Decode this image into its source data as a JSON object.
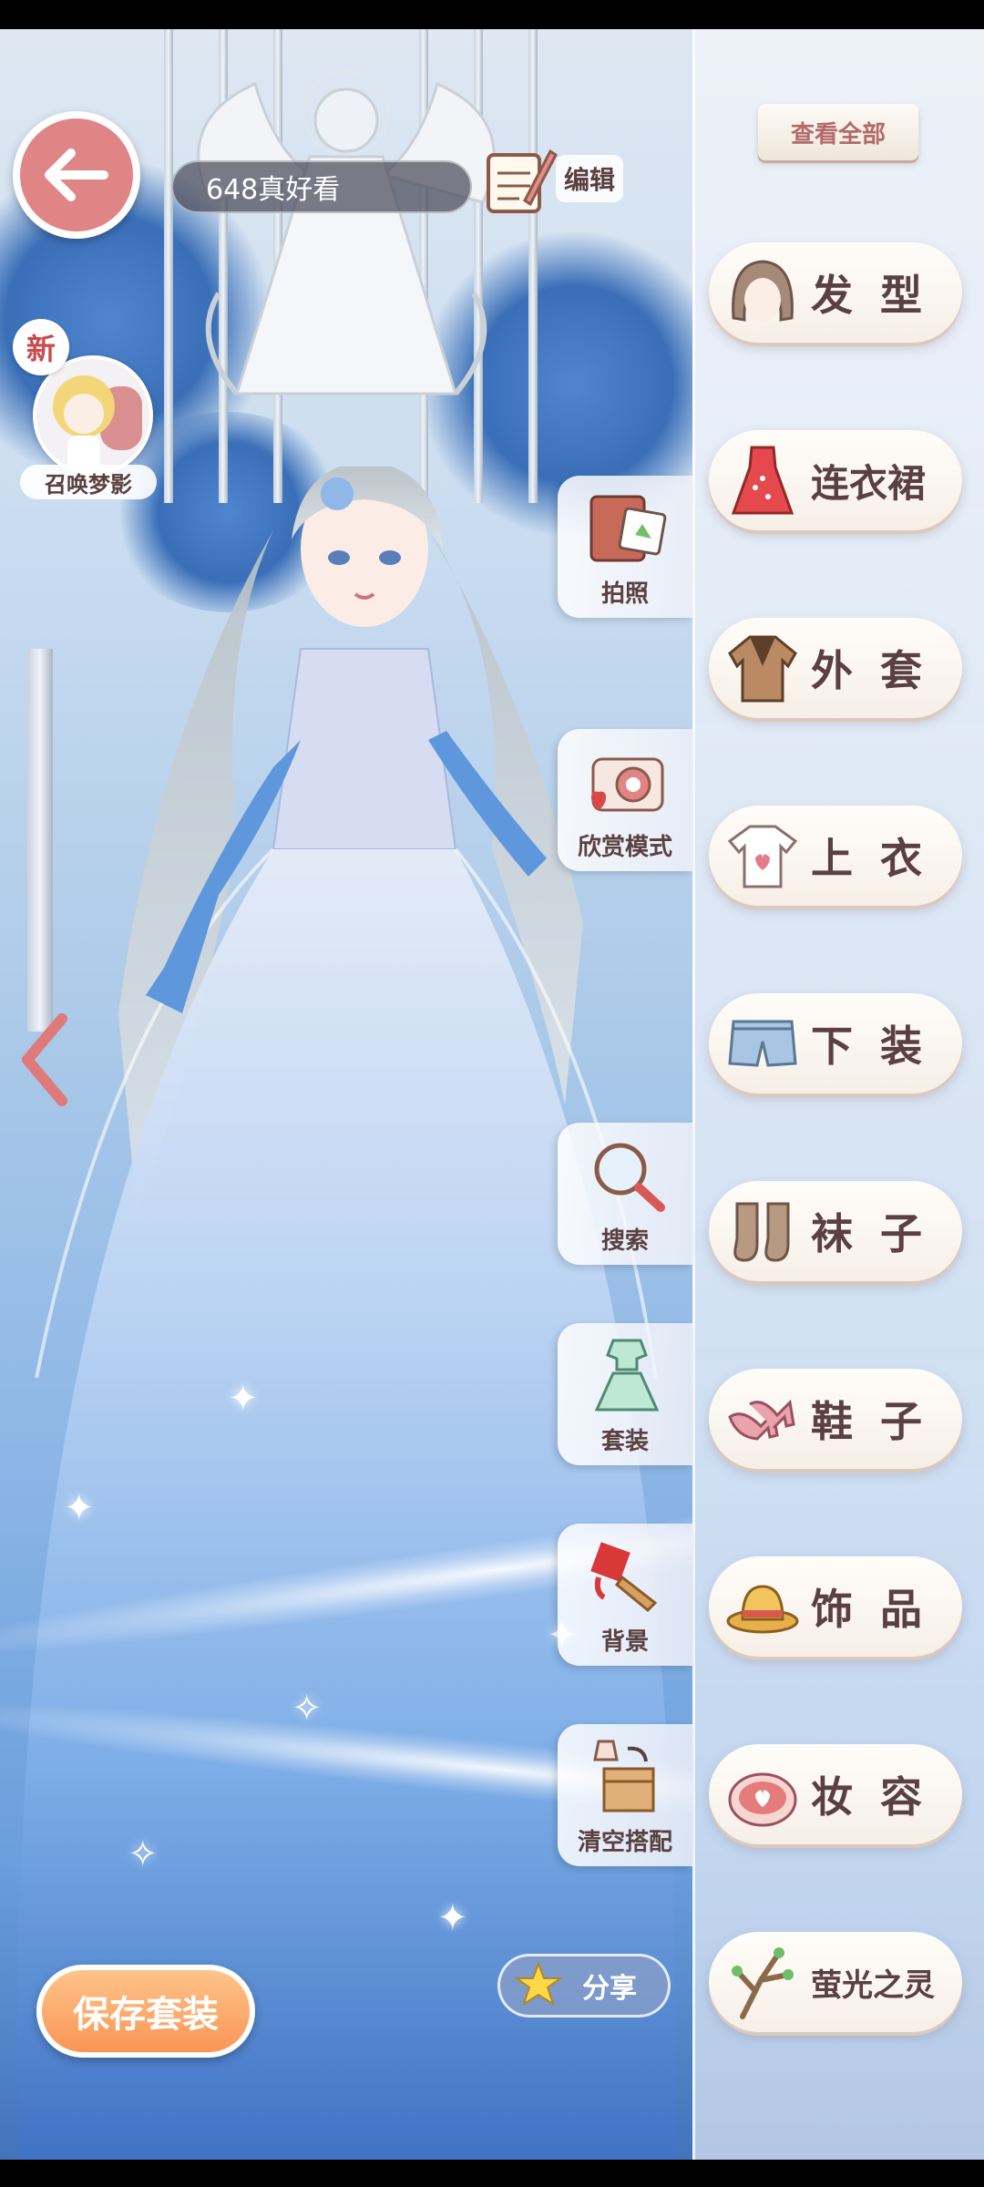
{
  "header": {
    "outfit_name": "648真好看",
    "edit_label": "编辑"
  },
  "summon": {
    "new_badge": "新",
    "label": "召唤梦影"
  },
  "panel": {
    "view_all": "查看全部",
    "categories": [
      {
        "label": "发型",
        "icon": "hair-icon"
      },
      {
        "label": "连衣裙",
        "icon": "dress-icon"
      },
      {
        "label": "外套",
        "icon": "coat-icon"
      },
      {
        "label": "上衣",
        "icon": "shirt-icon"
      },
      {
        "label": "下装",
        "icon": "shorts-icon"
      },
      {
        "label": "袜子",
        "icon": "socks-icon"
      },
      {
        "label": "鞋子",
        "icon": "shoes-icon"
      },
      {
        "label": "饰品",
        "icon": "hat-icon"
      },
      {
        "label": "妆容",
        "icon": "makeup-icon"
      },
      {
        "label": "萤光之灵",
        "icon": "branch-icon"
      }
    ]
  },
  "tools": [
    {
      "label": "拍照",
      "icon": "photo-album-icon"
    },
    {
      "label": "欣赏模式",
      "icon": "camera-icon"
    },
    {
      "label": "搜索",
      "icon": "magnifier-icon"
    },
    {
      "label": "套装",
      "icon": "outfit-set-icon"
    },
    {
      "label": "背景",
      "icon": "paint-brush-icon"
    },
    {
      "label": "清空搭配",
      "icon": "clear-box-icon"
    }
  ],
  "footer": {
    "save_label": "保存套装",
    "share_label": "分享"
  },
  "colors": {
    "back_button": "#e08585",
    "save_button": "#f99556",
    "category_text": "#5a4040"
  }
}
